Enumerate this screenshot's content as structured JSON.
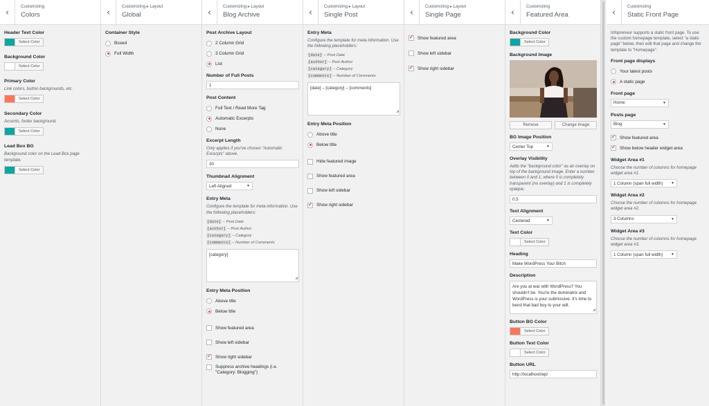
{
  "panels": {
    "colors": {
      "crumb": "Customizing",
      "title": "Colors",
      "controls": [
        {
          "title": "Header Text Color",
          "desc": "",
          "swatch": "#0fa5a0",
          "button": "Select Color"
        },
        {
          "title": "Background Color",
          "desc": "",
          "swatch": "#ffffff",
          "button": "Select Color"
        },
        {
          "title": "Primary Color",
          "desc": "Link colors, button backgrounds, etc.",
          "swatch": "#f8785d",
          "button": "Select Color"
        },
        {
          "title": "Secondary Color",
          "desc": "Accents, footer background.",
          "swatch": "#0fa5a0",
          "button": "Select Color"
        },
        {
          "title": "Lead Box BG",
          "desc": "Background color on the Lead Box page template.",
          "swatch": "#0fa5a0",
          "button": "Select Color"
        }
      ]
    },
    "global": {
      "crumb": "Customizing ▸ Layout",
      "title": "Global",
      "container_title": "Container Style",
      "options": [
        {
          "label": "Boxed",
          "checked": false
        },
        {
          "label": "Full Width",
          "checked": true
        }
      ]
    },
    "blog": {
      "crumb": "Customizing ▸ Layout",
      "title": "Blog Archive",
      "layout_title": "Post Archive Layout",
      "layout_options": [
        {
          "label": "2 Column Grid",
          "checked": false
        },
        {
          "label": "3 Column Grid",
          "checked": false
        },
        {
          "label": "List",
          "checked": true
        }
      ],
      "full_posts_title": "Number of Full Posts",
      "full_posts_value": "1",
      "content_title": "Post Content",
      "content_options": [
        {
          "label": "Full Text / Read More Tag",
          "checked": false
        },
        {
          "label": "Automatic Excerpts",
          "checked": true
        },
        {
          "label": "None",
          "checked": false
        }
      ],
      "excerpt_title": "Excerpt Length",
      "excerpt_desc": "Only applies if you've chosen \"Automatic Excerpts\" above.",
      "excerpt_value": "30",
      "thumb_title": "Thumbnail Alignment",
      "thumb_value": "Left Aligned",
      "meta_title": "Entry Meta",
      "meta_desc": "Configure the template for meta information. Use the following placeholders:",
      "placeholders": [
        {
          "code": "[date]",
          "label": "– Post Date"
        },
        {
          "code": "[author]",
          "label": "– Post Author"
        },
        {
          "code": "[category]",
          "label": "– Category"
        },
        {
          "code": "[comments]",
          "label": "– Number of Comments"
        }
      ],
      "meta_value": "[category]",
      "pos_title": "Entry Meta Position",
      "pos_options": [
        {
          "label": "Above title",
          "checked": false
        },
        {
          "label": "Below title",
          "checked": true
        }
      ],
      "checks": [
        {
          "label": "Show featured area",
          "checked": false
        },
        {
          "label": "Show left sidebar",
          "checked": false
        },
        {
          "label": "Show right sidebar",
          "checked": true
        },
        {
          "label": "Suppress archive headings (i.e. \"Category: Blogging\")",
          "checked": false
        }
      ]
    },
    "single_post": {
      "crumb": "Customizing ▸ Layout",
      "title": "Single Post",
      "meta_title": "Entry Meta",
      "meta_desc": "Configure the template for meta information. Use the following placeholders:",
      "placeholders": [
        {
          "code": "[date]",
          "label": "– Post Date"
        },
        {
          "code": "[author]",
          "label": "– Post Author"
        },
        {
          "code": "[category]",
          "label": "– Category"
        },
        {
          "code": "[comments]",
          "label": "– Number of Comments"
        }
      ],
      "meta_value": "[date] – [category] – [comments]",
      "pos_title": "Entry Meta Position",
      "pos_options": [
        {
          "label": "Above title",
          "checked": false
        },
        {
          "label": "Below title",
          "checked": true
        }
      ],
      "checks": [
        {
          "label": "Hide featured image",
          "checked": false
        },
        {
          "label": "Show featured area",
          "checked": false
        },
        {
          "label": "Show left sidebar",
          "checked": false
        },
        {
          "label": "Show right sidebar",
          "checked": true
        }
      ]
    },
    "single_page": {
      "crumb": "Customizing ▸ Layout",
      "title": "Single Page",
      "checks": [
        {
          "label": "Show featured area",
          "checked": true
        },
        {
          "label": "Show left sidebar",
          "checked": false
        },
        {
          "label": "Show right sidebar",
          "checked": true
        }
      ]
    },
    "featured": {
      "crumb": "Customizing",
      "title": "Featured Area",
      "bg_color_title": "Background Color",
      "bg_color": "#0fa5a0",
      "select_label": "Select Color",
      "bg_image_title": "Background Image",
      "remove_label": "Remove",
      "change_label": "Change Image",
      "bg_pos_title": "BG Image Position",
      "bg_pos_value": "Center Top",
      "overlay_title": "Overlay Visibility",
      "overlay_desc": "Adds the \"background color\" as an overlay on top of the background image. Enter a number between 0 and 1, where 0 is completely transparent (no overlay) and 1 is completely opaque.",
      "overlay_value": "0.5",
      "text_align_title": "Text Alignment",
      "text_align_value": "Centered",
      "text_color_title": "Text Color",
      "text_color": "#ffffff",
      "heading_title": "Heading",
      "heading_value": "Make WordPress Your Bitch",
      "desc_title": "Description",
      "desc_value": "Are you at war with WordPress? You shouldn't be. You're the dominatrix and WordPress is your submissive. It's time to bend that bad boy to your will.",
      "btn_bg_title": "Button BG Color",
      "btn_bg": "#f8785d",
      "btn_text_title": "Button Text Color",
      "btn_text": "#ffffff",
      "btn_url_title": "Button URL",
      "btn_url_value": "http://localhost/wp/"
    },
    "front": {
      "crumb": "Customizing",
      "title": "Static Front Page",
      "intro": "Infopreneur supports a static front page. To use the custom homepage template, select \"a static page\" below, then edit that page and change the template to \"Homepage\".",
      "displays_title": "Front page displays",
      "displays_options": [
        {
          "label": "Your latest posts",
          "checked": false
        },
        {
          "label": "A static page",
          "checked": true
        }
      ],
      "front_title": "Front page",
      "front_value": "Home",
      "posts_title": "Posts page",
      "posts_value": "Blog",
      "checks": [
        {
          "label": "Show featured area",
          "checked": true
        },
        {
          "label": "Show below header widget area",
          "checked": true
        }
      ],
      "widgets": [
        {
          "title": "Widget Area #1",
          "desc": "Choose the number of columns for homepage widget area #1.",
          "value": "1 Column (span full width)"
        },
        {
          "title": "Widget Area #2",
          "desc": "Choose the number of columns for homepage widget area #2.",
          "value": "3 Columns"
        },
        {
          "title": "Widget Area #3",
          "desc": "Choose the number of columns for homepage widget area #3.",
          "value": "1 Column (span full width)"
        }
      ]
    }
  },
  "colors": {
    "accent": "#e14d43",
    "panel_bg": "#f1f1f1"
  }
}
